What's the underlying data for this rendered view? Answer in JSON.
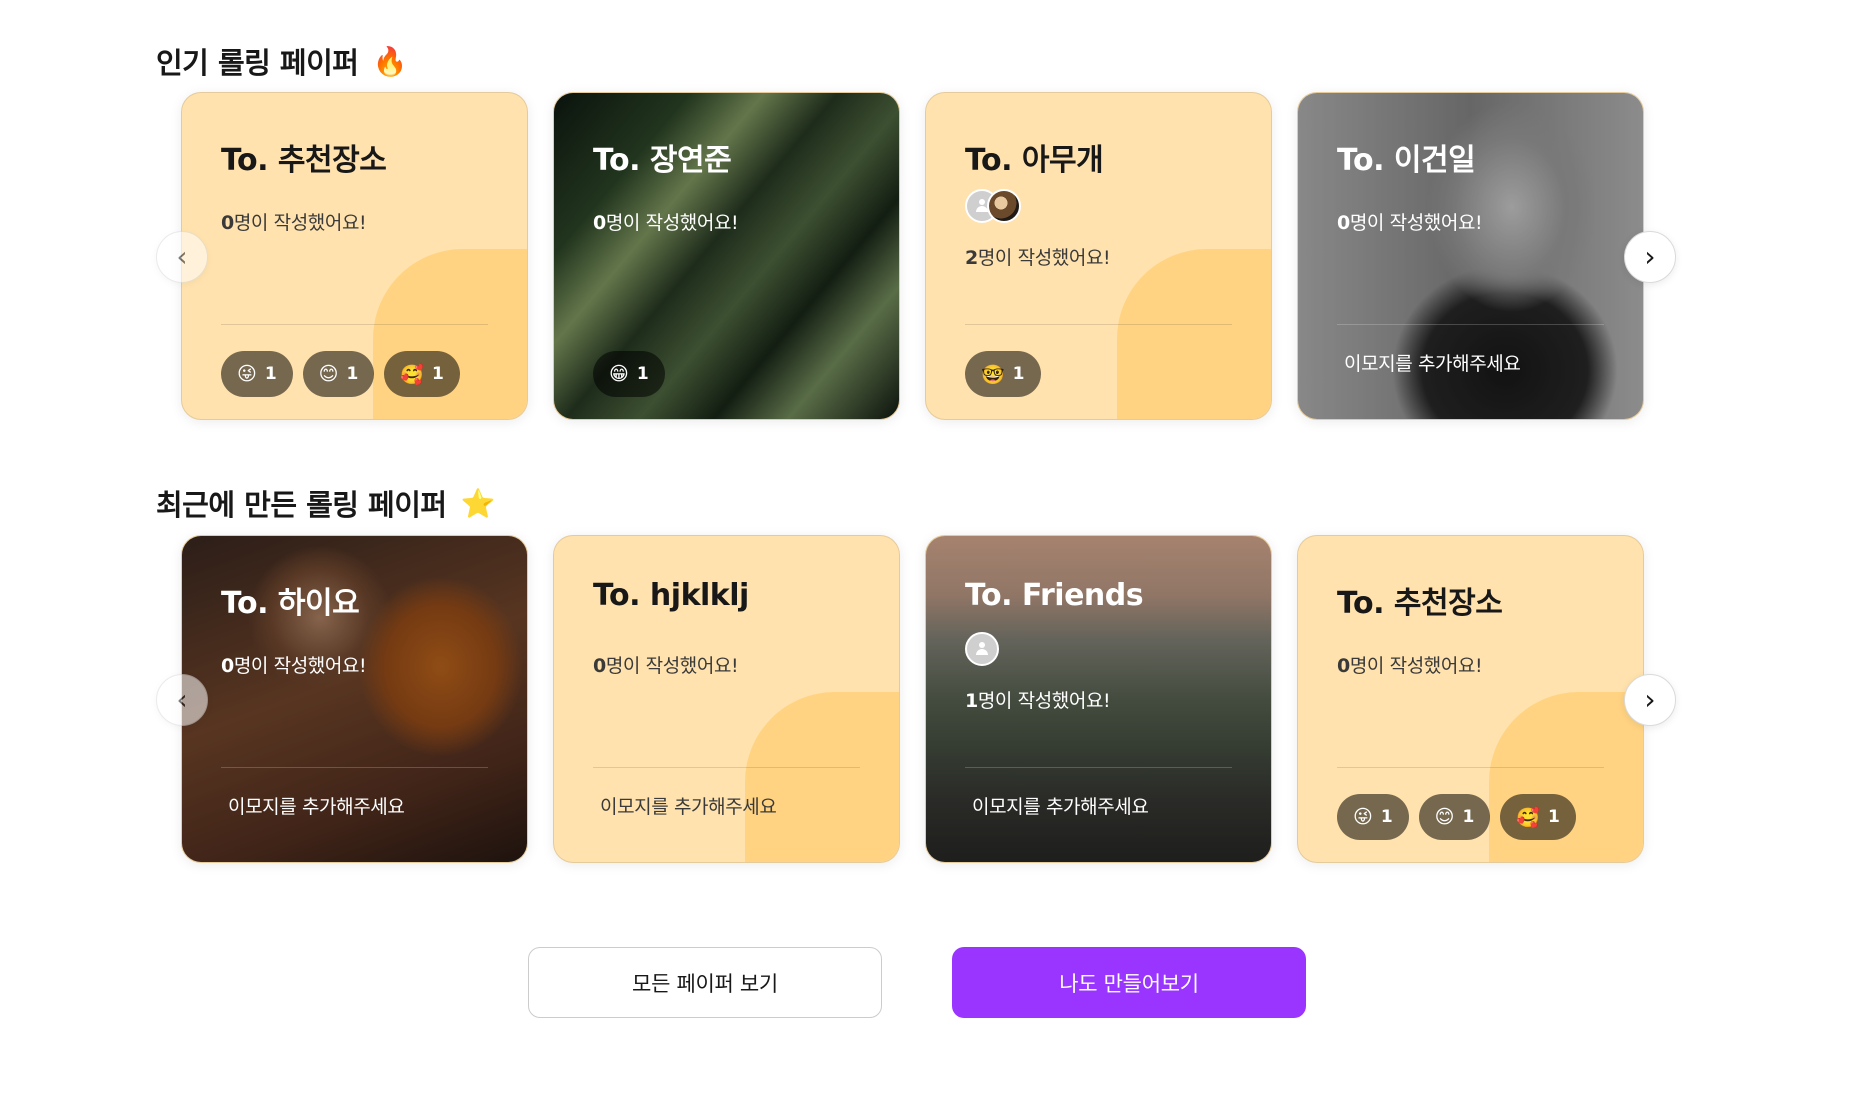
{
  "popular": {
    "title": "인기 롤링 페이퍼",
    "title_emoji": "🔥",
    "cards": [
      {
        "to": "To. 추천장소",
        "count": "0",
        "count_suffix": "명이 작성했어요!",
        "reactions": [
          {
            "emoji": "😜",
            "count": "1"
          },
          {
            "emoji": "😊",
            "count": "1"
          },
          {
            "emoji": "🥰",
            "count": "1"
          }
        ]
      },
      {
        "to": "To. 장연준",
        "count": "0",
        "count_suffix": "명이 작성했어요!",
        "reactions": [
          {
            "emoji": "😁",
            "count": "1"
          }
        ]
      },
      {
        "to": "To. 아무개",
        "count": "2",
        "count_suffix": "명이 작성했어요!",
        "reactions": [
          {
            "emoji": "🤓",
            "count": "1"
          }
        ]
      },
      {
        "to": "To. 이건일",
        "count": "0",
        "count_suffix": "명이 작성했어요!",
        "add_emoji": "이모지를 추가해주세요"
      }
    ]
  },
  "recent": {
    "title": "최근에 만든 롤링 페이퍼",
    "title_emoji": "⭐",
    "cards": [
      {
        "to": "To. 하이요",
        "count": "0",
        "count_suffix": "명이 작성했어요!",
        "add_emoji": "이모지를 추가해주세요"
      },
      {
        "to": "To. hjklklj",
        "count": "0",
        "count_suffix": "명이 작성했어요!",
        "add_emoji": "이모지를 추가해주세요"
      },
      {
        "to": "To. Friends",
        "count": "1",
        "count_suffix": "명이 작성했어요!",
        "add_emoji": "이모지를 추가해주세요"
      },
      {
        "to": "To. 추천장소",
        "count": "0",
        "count_suffix": "명이 작성했어요!",
        "reactions": [
          {
            "emoji": "😜",
            "count": "1"
          },
          {
            "emoji": "😊",
            "count": "1"
          },
          {
            "emoji": "🥰",
            "count": "1"
          }
        ]
      }
    ]
  },
  "nav": {
    "prev_icon": "‹",
    "next_icon": "›"
  },
  "buttons": {
    "all_papers": "모든 페이퍼 보기",
    "create": "나도 만들어보기"
  },
  "colors": {
    "accent": "#9935FF",
    "card_beige": "#FFE2AD",
    "card_beige_deco": "#FFD382"
  }
}
